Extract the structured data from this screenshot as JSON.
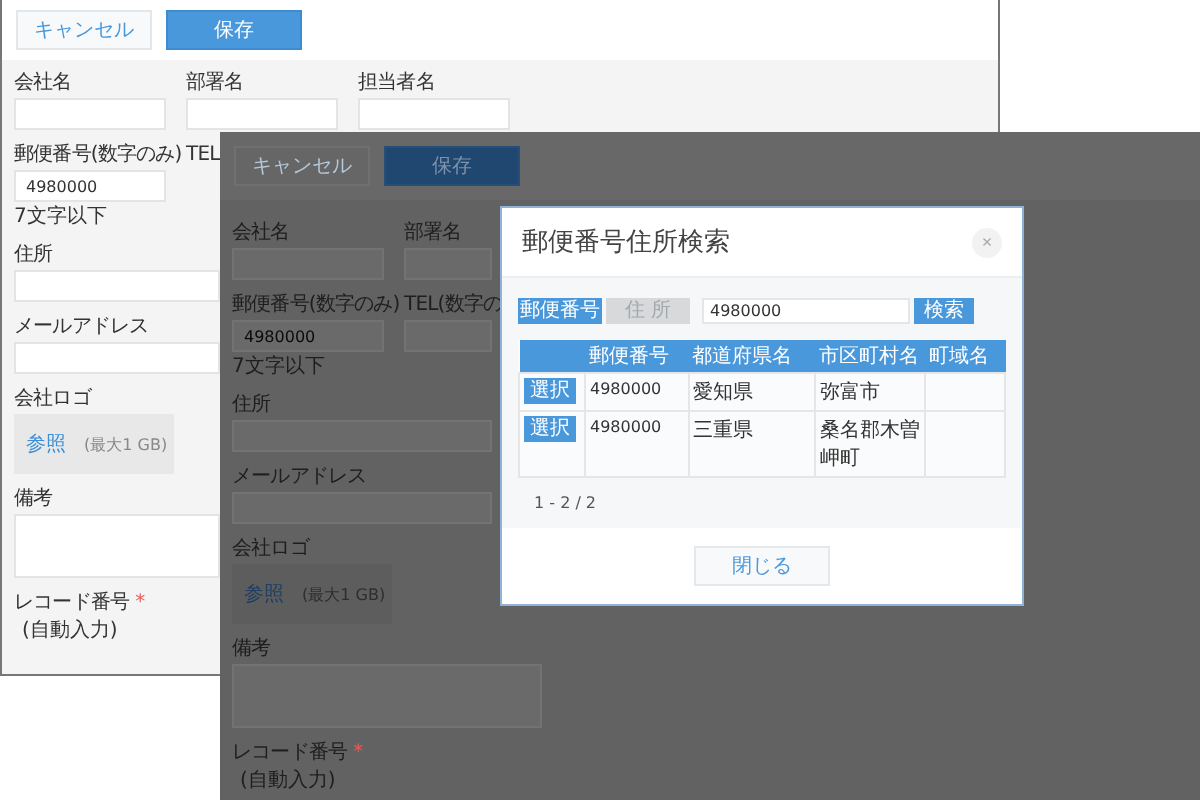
{
  "windows": [
    {
      "dimmed": false,
      "buttons": [
        {
          "label": "キャンセル",
          "kind": "secondary"
        },
        {
          "label": "保存",
          "kind": "primary"
        }
      ],
      "rows": [
        {
          "fields": [
            {
              "label": "会社名",
              "kind": "input"
            },
            {
              "label": "部署名",
              "kind": "input"
            },
            {
              "label": "担当者名",
              "kind": "input"
            }
          ]
        },
        {
          "fields": [
            {
              "label": "郵便番号(数字のみ)",
              "kind": "input",
              "value": "4980000",
              "hint": "7文字以下"
            },
            {
              "label": "TEL",
              "kind": "label"
            }
          ]
        },
        {
          "fields": [
            {
              "label": "住所",
              "kind": "wide"
            }
          ]
        },
        {
          "fields": [
            {
              "label": "メールアドレス",
              "kind": "wide"
            }
          ]
        },
        {
          "fields": [
            {
              "label": "会社ロゴ",
              "kind": "file",
              "link": "参照",
              "note": "(最大1 GB)"
            }
          ]
        },
        {
          "fields": [
            {
              "label": "備考",
              "kind": "textarea"
            }
          ]
        },
        {
          "fields": [
            {
              "label": "レコード番号",
              "kind": "auto",
              "required_mark": "*",
              "value": "(自動入力)"
            }
          ]
        }
      ]
    },
    {
      "dimmed": true,
      "buttons": [
        {
          "label": "キャンセル",
          "kind": "secondary"
        },
        {
          "label": "保存",
          "kind": "primary"
        }
      ],
      "rows": [
        {
          "fields": [
            {
              "label": "会社名",
              "kind": "input"
            },
            {
              "label": "部署名",
              "kind": "input"
            }
          ]
        },
        {
          "fields": [
            {
              "label": "郵便番号(数字のみ)",
              "kind": "input",
              "value": "4980000",
              "hint": "7文字以下"
            },
            {
              "label": "TEL(数字の",
              "kind": "input"
            }
          ]
        },
        {
          "fields": [
            {
              "label": "住所",
              "kind": "wide"
            }
          ]
        },
        {
          "fields": [
            {
              "label": "メールアドレス",
              "kind": "wide"
            }
          ]
        },
        {
          "fields": [
            {
              "label": "会社ロゴ",
              "kind": "file",
              "link": "参照",
              "note": "(最大1 GB)"
            }
          ]
        },
        {
          "fields": [
            {
              "label": "備考",
              "kind": "textarea"
            }
          ]
        },
        {
          "fields": [
            {
              "label": "レコード番号",
              "kind": "auto",
              "required_mark": "*",
              "value": "(自動入力)"
            }
          ]
        }
      ],
      "modal": {
        "title": "郵便番号住所検索",
        "close": "×",
        "tabs": [
          {
            "label": "郵便番号",
            "selected": true
          },
          {
            "label": "住 所",
            "selected": false
          }
        ],
        "search_value": "4980000",
        "search_button": "検索",
        "columns": [
          "郵便番号",
          "都道府県名",
          "市区町村名",
          "町域名"
        ],
        "rows": [
          {
            "action": "選択",
            "postal_code": "4980000",
            "prefecture": "愛知県",
            "city": "弥富市"
          },
          {
            "action": "選択",
            "postal_code": "4980000",
            "prefecture": "三重県",
            "city": "桑名郡木曽岬町"
          }
        ],
        "pagination": "1 - 2 / 2",
        "close_button": "閉じる"
      }
    }
  ]
}
